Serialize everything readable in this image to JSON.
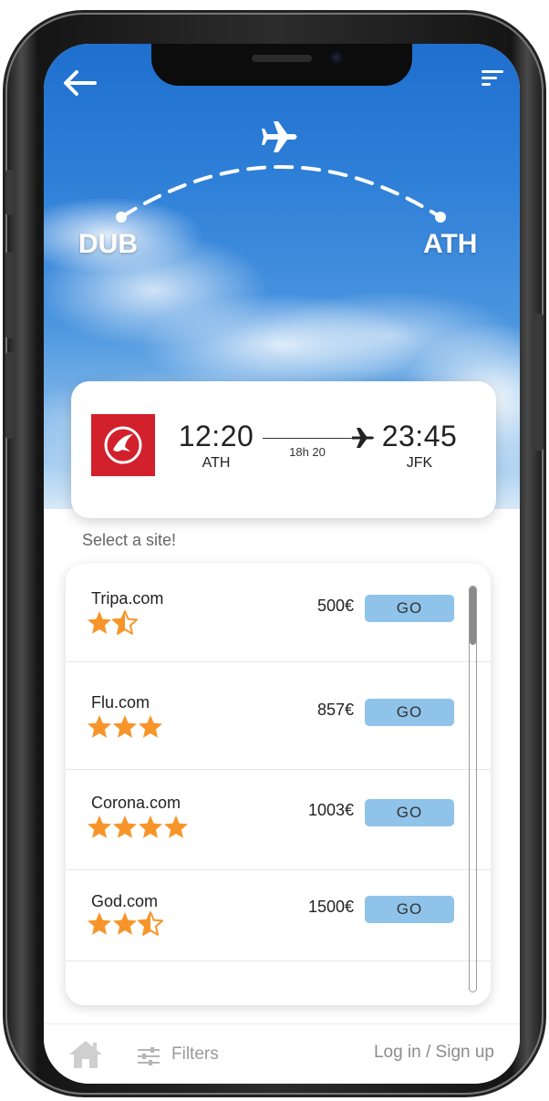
{
  "route": {
    "from": "DUB",
    "to": "ATH"
  },
  "flight": {
    "departure_time": "12:20",
    "departure_code": "ATH",
    "duration": "18h 20",
    "arrival_time": "23:45",
    "arrival_code": "JFK"
  },
  "select_label": "Select a site!",
  "sites": [
    {
      "name": "Tripa.com",
      "rating": 1.5,
      "price": "500€",
      "go_label": "GO"
    },
    {
      "name": "Flu.com",
      "rating": 3,
      "price": "857€",
      "go_label": "GO"
    },
    {
      "name": "Corona.com",
      "rating": 4,
      "price": "1003€",
      "go_label": "GO"
    },
    {
      "name": "God.com",
      "rating": 2.5,
      "price": "1500€",
      "go_label": "GO"
    }
  ],
  "bottom_nav": {
    "filters_label": "Filters",
    "login_label": "Log in / Sign up"
  },
  "colors": {
    "go_button": "#8fc3ea",
    "star": "#f7952a",
    "airline": "#d2202c"
  },
  "icons": [
    "back-arrow-icon",
    "sort-icon",
    "airplane-icon",
    "home-icon",
    "filters-icon",
    "star-icon"
  ]
}
